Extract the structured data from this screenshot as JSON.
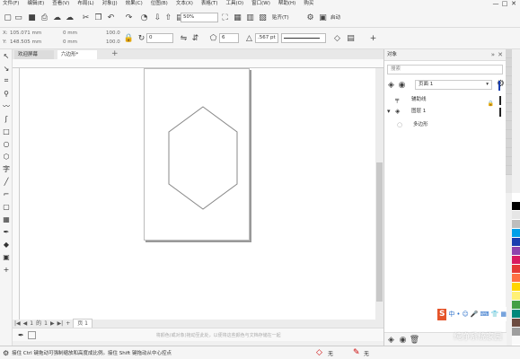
{
  "menu": {
    "items": [
      "文件(F)",
      "编辑(E)",
      "查看(V)",
      "布局(L)",
      "对象(J)",
      "效果(C)",
      "位图(B)",
      "文本(X)",
      "表格(T)",
      "工具(O)",
      "窗口(W)",
      "帮助(H)",
      "购买"
    ],
    "window_controls": [
      "—",
      "□",
      "✕"
    ]
  },
  "toolbar1": {
    "zoom_value": "50%",
    "snap_label": "贴齐(T)",
    "launch_label": "启动"
  },
  "toolbar2": {
    "x_value": "105.071 mm",
    "y_value": "148.505 mm",
    "w_value": "0 mm",
    "h_value": "0 mm",
    "scale_w": "100.0",
    "scale_h": "100.0",
    "rotation": "0",
    "sides": "6",
    "outline_width": ".567 pt"
  },
  "tabs": {
    "welcome": "欢迎屏幕",
    "document": "六边形*",
    "add": "+"
  },
  "page_nav": {
    "current": "1",
    "of": "的",
    "total": "1",
    "page_tab": "页 1"
  },
  "hint_bar": {
    "text": "将颜色(或对象)拖动至此处，以便将这些颜色与文档存储在一起"
  },
  "status": {
    "text": "接住 Ctrl 键拖动可强制缩放和高度成比例。接住 Shift 键拖动从中心控点",
    "fill_label": "无",
    "outline_label": "无"
  },
  "panel": {
    "title": "对象",
    "search_placeholder": "搜索",
    "page_select": "页面 1",
    "guides_label": "辅助线",
    "layer_label": "图层 1",
    "object_label": "多边形"
  },
  "ime": {
    "logo": "S",
    "lang": "中"
  },
  "watermark": "纯净系统家园",
  "palette_colors": [
    "#ffffff",
    "#000000",
    "#e6e6e6",
    "#bdbdbd",
    "#00a0e9",
    "#1a3fb0",
    "#8e44ad",
    "#d81b60",
    "#e53935",
    "#ff7043",
    "#ffd600",
    "#fff176",
    "#43a047",
    "#00897b",
    "#6d4c41",
    "#9e9e9e",
    "#fafafa"
  ],
  "colors": {
    "accent_blue": "#1a3fb0",
    "ime_orange": "#e5542a"
  }
}
